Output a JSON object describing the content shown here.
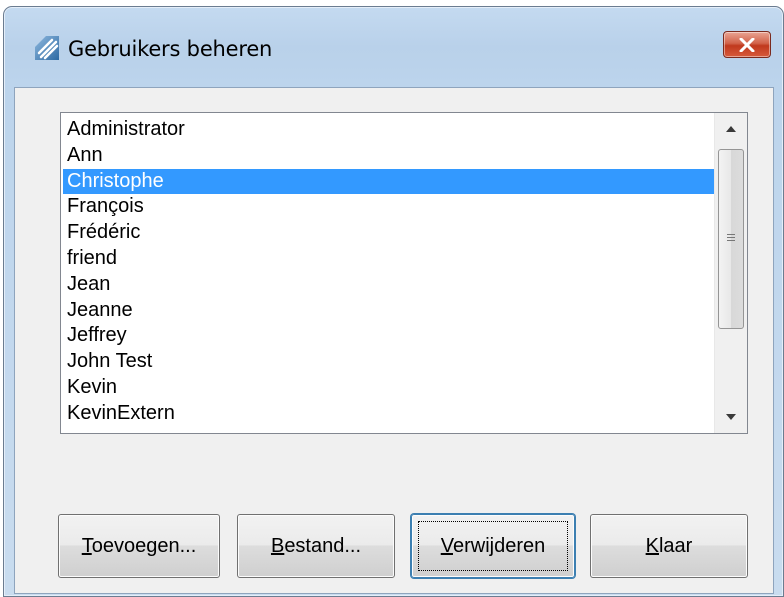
{
  "window": {
    "title": "Gebruikers beheren",
    "icon": "app-logo-icon",
    "close_icon": "close-icon"
  },
  "users": {
    "items": [
      "Administrator",
      "Ann",
      "Christophe",
      "François",
      "Frédéric",
      "friend",
      "Jean",
      "Jeanne",
      "Jeffrey",
      "John Test",
      "Kevin",
      "KevinExtern"
    ],
    "selected": "Christophe"
  },
  "buttons": {
    "add": {
      "mnemonic": "T",
      "rest": "oevoegen..."
    },
    "file": {
      "mnemonic": "B",
      "rest": "estand..."
    },
    "remove": {
      "mnemonic": "V",
      "rest": "erwijderen"
    },
    "done": {
      "mnemonic": "K",
      "rest": "laar"
    }
  },
  "colors": {
    "selection": "#3399ff",
    "close_button": "#c0391e"
  }
}
